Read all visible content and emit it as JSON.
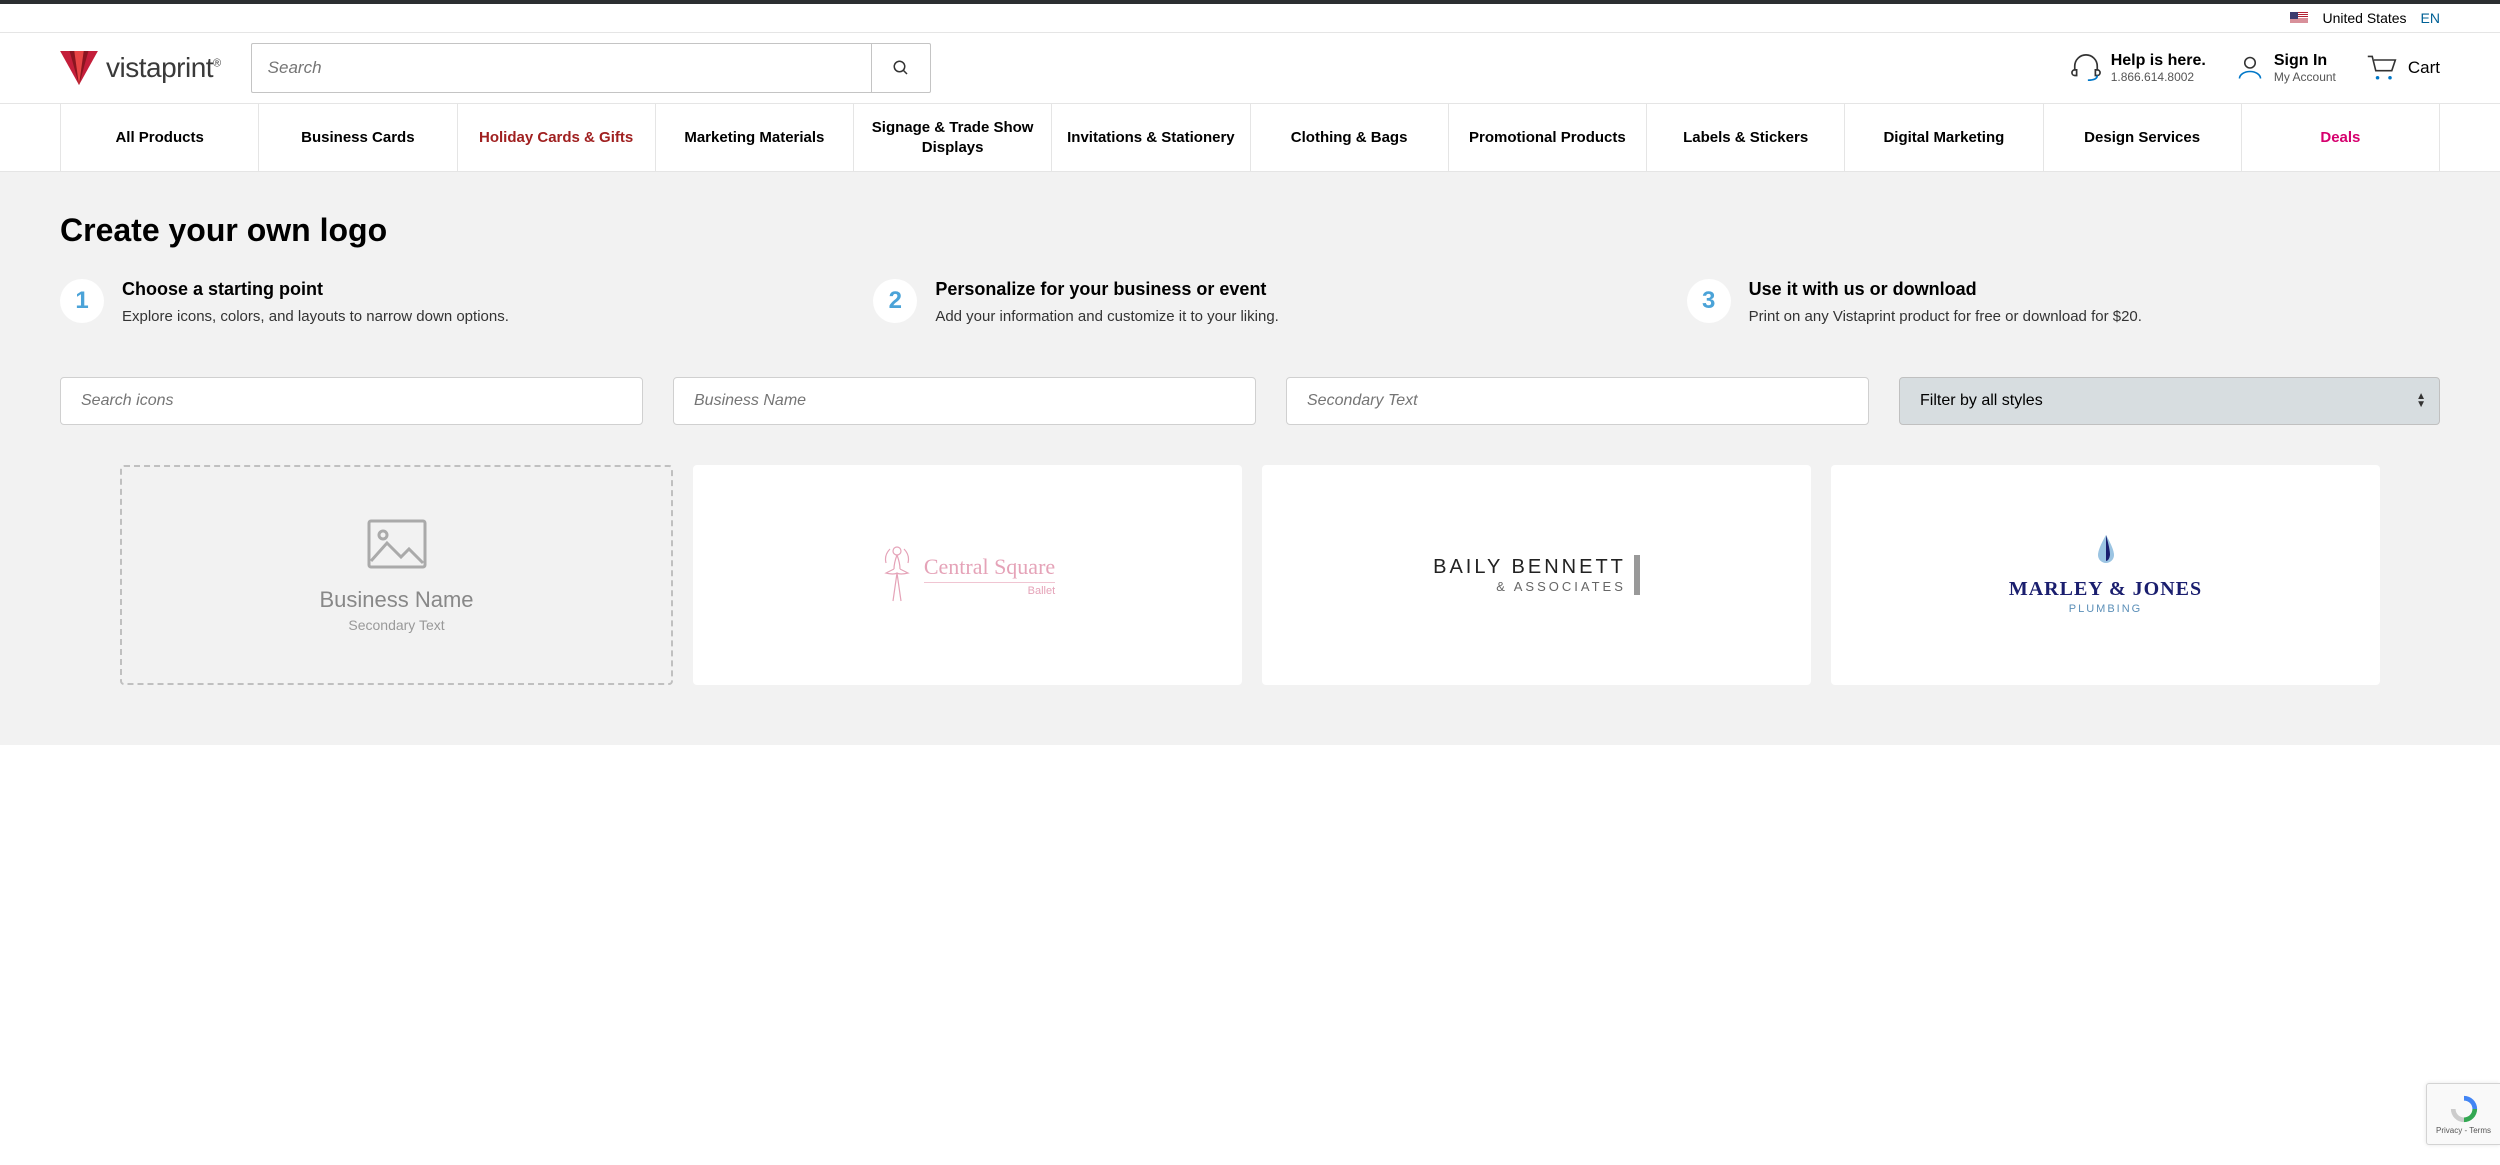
{
  "locale": {
    "country": "United States",
    "lang": "EN"
  },
  "brand": {
    "name": "vistaprint"
  },
  "search": {
    "placeholder": "Search"
  },
  "header": {
    "help_title": "Help is here.",
    "help_phone": "1.866.614.8002",
    "signin_title": "Sign In",
    "signin_sub": "My Account",
    "cart_label": "Cart"
  },
  "nav": [
    "All Products",
    "Business Cards",
    "Holiday Cards & Gifts",
    "Marketing Materials",
    "Signage & Trade Show Displays",
    "Invitations & Stationery",
    "Clothing & Bags",
    "Promotional Products",
    "Labels & Stickers",
    "Digital Marketing",
    "Design Services",
    "Deals"
  ],
  "page": {
    "title": "Create your own logo",
    "steps": [
      {
        "num": "1",
        "title": "Choose a starting point",
        "desc": "Explore icons, colors, and layouts to narrow down options."
      },
      {
        "num": "2",
        "title": "Personalize for your business or event",
        "desc": "Add your information and customize it to your liking."
      },
      {
        "num": "3",
        "title": "Use it with us or download",
        "desc": "Print on any Vistaprint product for free or download for $20."
      }
    ]
  },
  "filters": {
    "search_icons": "Search icons",
    "business_name": "Business Name",
    "secondary_text": "Secondary Text",
    "style_filter": "Filter by all styles"
  },
  "logo_cards": {
    "placeholder": {
      "title": "Business Name",
      "sub": "Secondary Text"
    },
    "ballet": {
      "name": "Central Square",
      "sub": "Ballet"
    },
    "baily": {
      "name": "BAILY BENNETT",
      "sub": "& ASSOCIATES"
    },
    "marley": {
      "name": "MARLEY & JONES",
      "sub": "PLUMBING"
    }
  },
  "recaptcha": {
    "privacy": "Privacy",
    "terms": "Terms"
  }
}
